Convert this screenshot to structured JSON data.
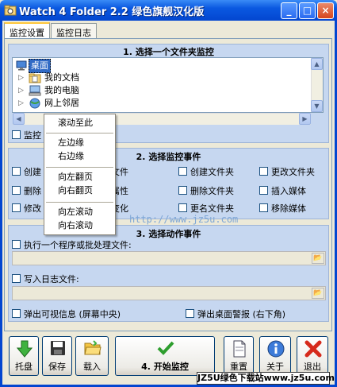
{
  "window": {
    "title": "Watch 4 Folder 2.2 绿色旗舰汉化版"
  },
  "titlebar_buttons": {
    "minimize": "_",
    "maximize": "□",
    "close": "×"
  },
  "tabs": [
    {
      "label": "监控设置",
      "active": true
    },
    {
      "label": "监控日志",
      "active": false
    }
  ],
  "section1": {
    "title": "1. 选择一个文件夹监控",
    "tree": [
      {
        "label": "桌面",
        "selected": true,
        "icon": "desktop-icon"
      },
      {
        "label": "我的文档",
        "icon": "documents-folder-icon"
      },
      {
        "label": "我的电脑",
        "icon": "computer-icon"
      },
      {
        "label": "网上邻居",
        "icon": "network-icon"
      }
    ],
    "monitor_sub_label": "监控"
  },
  "context_menu": {
    "items": [
      "滚动至此",
      "左边缘",
      "右边缘",
      "向左翻页",
      "向右翻页",
      "向左滚动",
      "向右滚动"
    ]
  },
  "section2": {
    "title": "2. 选择监控事件",
    "col1": [
      "创建",
      "删除",
      "修改"
    ],
    "col2": [
      "文件",
      "属性",
      "变化"
    ],
    "col3": [
      "创建文件夹",
      "删除文件夹",
      "更名文件夹"
    ],
    "col4": [
      "更改文件夹",
      "插入媒体",
      "移除媒体"
    ]
  },
  "watermark": "http://www.jz5u.com",
  "section3": {
    "title": "3. 选择动作事件",
    "run_program": "执行一个程序或批处理文件:",
    "write_log": "写入日志文件:",
    "popup_info": "弹出可视信息 (屏幕中央)",
    "desktop_alert": "弹出桌面警报 (右下角)"
  },
  "buttons": {
    "tray": "托盘",
    "save": "保存",
    "load": "载入",
    "start": "4. 开始监控",
    "reset": "重置",
    "about": "关于",
    "exit": "退出"
  },
  "banner": "JZ5U绿色下载站www.jz5u.com",
  "colors": {
    "titlebar": "#0A58E0",
    "group_bg": "#C6D7F0",
    "watermark": "#7FA7D6"
  }
}
